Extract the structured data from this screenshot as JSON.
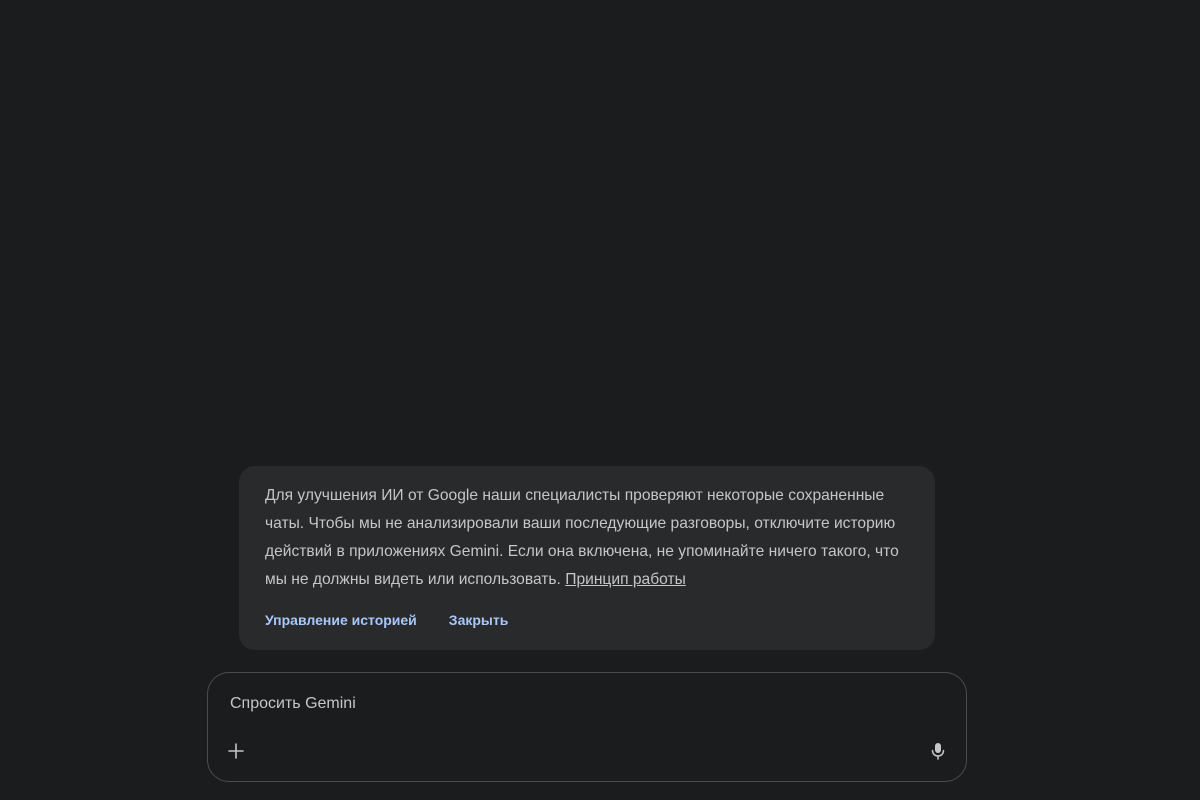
{
  "notice": {
    "text": "Для улучшения ИИ от Google наши специалисты проверяют некоторые сохраненные чаты. Чтобы мы не анализировали ваши последующие разговоры, отключите историю действий в приложениях Gemini. Если она включена, не упоминайте ничего такого, что мы не должны видеть или использовать.",
    "link_label": "Принцип работы",
    "manage_history_label": "Управление историей",
    "close_label": "Закрыть"
  },
  "composer": {
    "placeholder": "Спросить Gemini",
    "value": "",
    "add_icon": "plus-icon",
    "mic_icon": "microphone-icon"
  },
  "colors": {
    "background": "#1b1c1d",
    "notice_background": "#282a2c",
    "accent": "#a8c7fa",
    "text": "#c4c7c5",
    "composer_border": "#4a4d50"
  }
}
